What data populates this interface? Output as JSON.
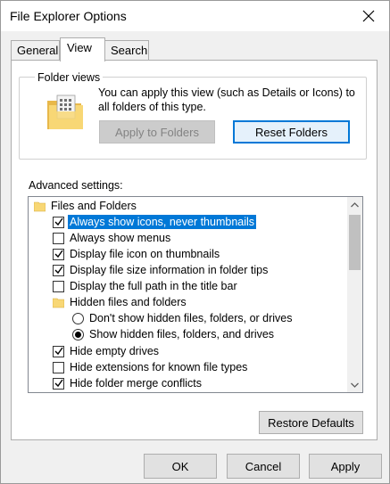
{
  "window": {
    "title": "File Explorer Options"
  },
  "tabs": [
    {
      "label": "General"
    },
    {
      "label": "View"
    },
    {
      "label": "Search"
    }
  ],
  "folder_views": {
    "group_label": "Folder views",
    "description": "You can apply this view (such as Details or Icons) to all folders of this type.",
    "apply_label": "Apply to Folders",
    "reset_label": "Reset Folders"
  },
  "advanced": {
    "label": "Advanced settings:",
    "items": [
      {
        "type": "folder",
        "label": "Files and Folders"
      },
      {
        "type": "checkbox",
        "checked": true,
        "label": "Always show icons, never thumbnails",
        "selected": true
      },
      {
        "type": "checkbox",
        "checked": false,
        "label": "Always show menus"
      },
      {
        "type": "checkbox",
        "checked": true,
        "label": "Display file icon on thumbnails"
      },
      {
        "type": "checkbox",
        "checked": true,
        "label": "Display file size information in folder tips"
      },
      {
        "type": "checkbox",
        "checked": false,
        "label": "Display the full path in the title bar"
      },
      {
        "type": "folder",
        "label": "Hidden files and folders"
      },
      {
        "type": "radio",
        "checked": false,
        "label": "Don't show hidden files, folders, or drives"
      },
      {
        "type": "radio",
        "checked": true,
        "label": "Show hidden files, folders, and drives"
      },
      {
        "type": "checkbox",
        "checked": true,
        "label": "Hide empty drives"
      },
      {
        "type": "checkbox",
        "checked": false,
        "label": "Hide extensions for known file types"
      },
      {
        "type": "checkbox",
        "checked": true,
        "label": "Hide folder merge conflicts"
      }
    ]
  },
  "restore_defaults_label": "Restore Defaults",
  "footer": {
    "ok": "OK",
    "cancel": "Cancel",
    "apply": "Apply"
  },
  "colors": {
    "accent": "#0078d7",
    "folder": "#f8d775"
  }
}
